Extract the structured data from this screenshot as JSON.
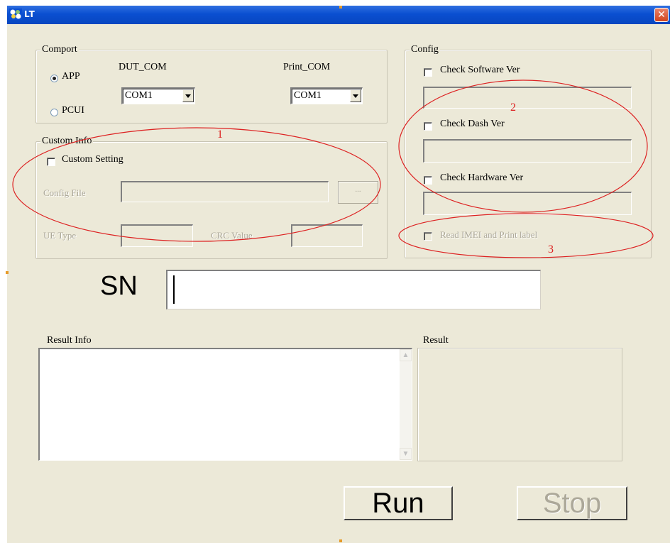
{
  "window": {
    "title": "LT",
    "close_symbol": "✕"
  },
  "comport": {
    "legend": "Comport",
    "app_label": "APP",
    "pcui_label": "PCUI",
    "app_selected": true,
    "dut_com_label": "DUT_COM",
    "dut_com_value": "COM1",
    "print_com_label": "Print_COM",
    "print_com_value": "COM1"
  },
  "custom_info": {
    "legend": "Custom Info",
    "custom_setting_label": "Custom Setting",
    "config_file_label": "Config File",
    "browse_label": "...",
    "ue_type_label": "UE Type",
    "crc_value_label": "CRC Value"
  },
  "config": {
    "legend": "Config",
    "check_software_label": "Check Software Ver",
    "check_dash_label": "Check Dash Ver",
    "check_hardware_label": "Check  Hardware Ver",
    "read_imei_label": "Read  IMEI and Print label"
  },
  "sn": {
    "label": "SN",
    "value": ""
  },
  "result_info": {
    "label": "Result Info",
    "text": ""
  },
  "result": {
    "label": "Result"
  },
  "buttons": {
    "run_label": "Run",
    "stop_label": "Stop"
  },
  "annotations": {
    "color": "#dd2222",
    "numbers": [
      "1",
      "2",
      "3"
    ]
  },
  "icons": [
    "app-icon",
    "close-icon",
    "combo-dropdown-icon",
    "scroll-up-icon",
    "scroll-down-icon"
  ]
}
